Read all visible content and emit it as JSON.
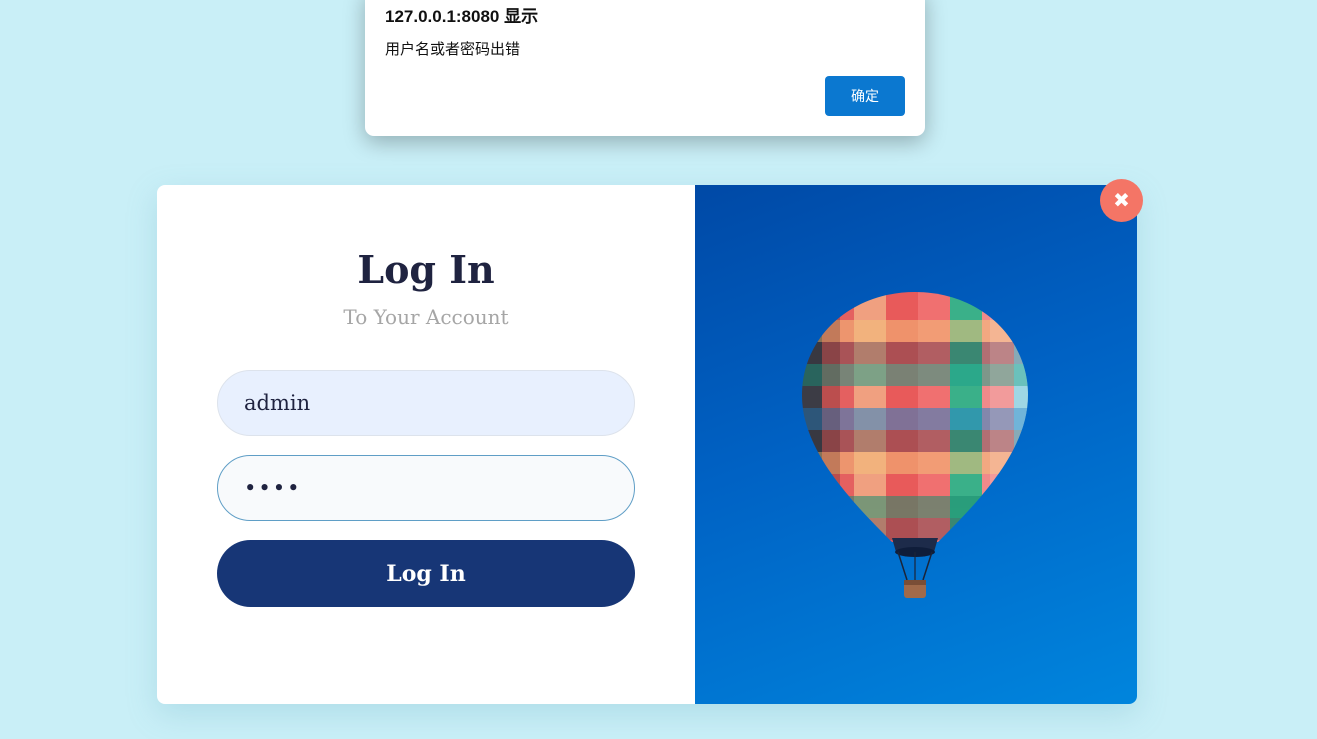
{
  "alert": {
    "title": "127.0.0.1:8080 显示",
    "message": "用户名或者密码出错",
    "ok_label": "确定"
  },
  "login": {
    "title": "Log In",
    "subtitle": "To Your Account",
    "username_value": "admin",
    "password_value": "••••",
    "button_label": "Log In"
  },
  "close": {
    "icon": "close-icon",
    "glyph": "✖"
  },
  "image": {
    "subject": "hot-air-balloon-icon"
  },
  "colors": {
    "page_background": "#c9eff7",
    "primary_button": "#173676",
    "alert_button": "#0b78d0",
    "close_button": "#f47566",
    "image_sky": "#0062c4"
  }
}
